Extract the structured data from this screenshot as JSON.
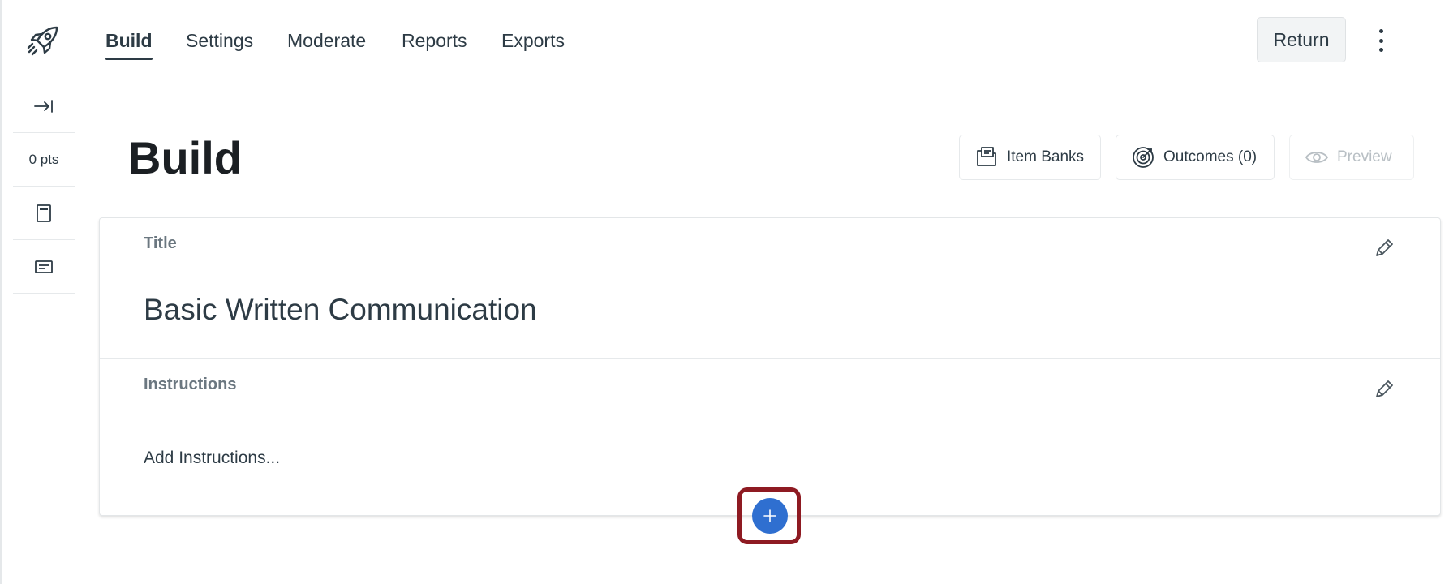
{
  "nav": {
    "tabs": [
      {
        "label": "Build"
      },
      {
        "label": "Settings"
      },
      {
        "label": "Moderate"
      },
      {
        "label": "Reports"
      },
      {
        "label": "Exports"
      }
    ],
    "active_tab": "Build",
    "return_label": "Return",
    "more_icon": "kebab-menu-icon",
    "logo_icon": "rocket-icon"
  },
  "rail": {
    "collapse_icon": "expand-right-icon",
    "points": "0 pts",
    "item_icons": [
      "page-icon",
      "text-block-icon"
    ]
  },
  "main": {
    "page_title": "Build",
    "actions": {
      "item_banks": "Item Banks",
      "outcomes": "Outcomes (0)",
      "preview": "Preview"
    },
    "card": {
      "title_label": "Title",
      "title_value": "Basic Written Communication",
      "instructions_label": "Instructions",
      "instructions_placeholder": "Add Instructions..."
    }
  },
  "colors": {
    "text": "#2d3b45",
    "muted": "#6b7780",
    "add_button": "#2f6fd0",
    "highlight": "#8e1a22"
  }
}
